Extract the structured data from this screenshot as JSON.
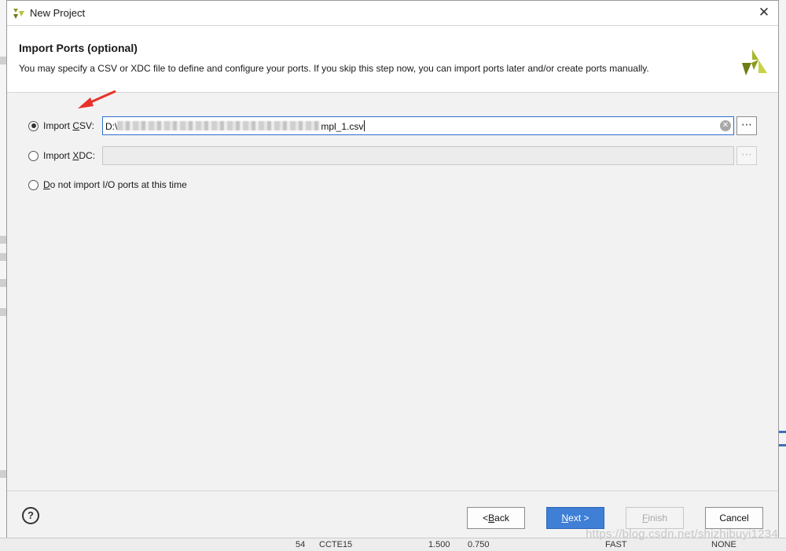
{
  "window": {
    "title": "New Project",
    "close_symbol": "✕"
  },
  "step": {
    "title": "Import Ports (optional)",
    "description": "You may specify a CSV or XDC file to define and configure your ports. If you skip this step now, you can import ports later and/or create ports manually."
  },
  "options": {
    "csv": {
      "pre": "Import ",
      "ul": "C",
      "post": "SV:",
      "checked": true,
      "path_prefix": "D:\\",
      "path_suffix": "mpl_1.csv"
    },
    "xdc": {
      "pre": "Import ",
      "ul": "X",
      "post": "DC:",
      "checked": false,
      "path_value": ""
    },
    "none": {
      "ul": "D",
      "post": "o not import I/O ports at this time",
      "checked": false
    }
  },
  "browse_label": "⋯",
  "clear_symbol": "✕",
  "footer": {
    "help_label": "?",
    "back": {
      "pre": "< ",
      "ul": "B",
      "post": "ack"
    },
    "next": {
      "ul": "N",
      "post": "ext >"
    },
    "finish": {
      "ul": "F",
      "post": "inish"
    },
    "cancel": "Cancel"
  },
  "background": {
    "bottom_cells": [
      "54",
      "CCTE15",
      "1.500",
      "0.750",
      "FAST",
      "NONE"
    ]
  },
  "watermark": "https://blog.csdn.net/shizhibuyi1234",
  "colors": {
    "accent": "#3f7fd6",
    "focus_border": "#2f6fcf",
    "arrow": "#e8312b",
    "logo_green": "#8a9a1e"
  },
  "icons": {
    "title_logo": "xilinx-logo-icon",
    "brand_logo": "xilinx-logo-icon",
    "help": "help-icon",
    "close": "close-icon",
    "clear": "clear-icon",
    "browse": "ellipsis-icon"
  }
}
